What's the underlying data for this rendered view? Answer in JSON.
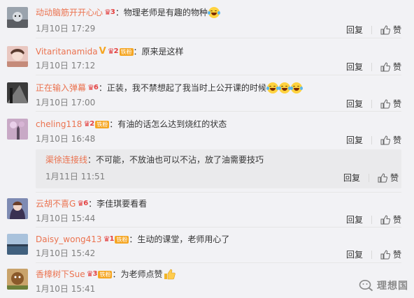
{
  "reply_label": "回复",
  "like_label": "赞",
  "comments": [
    {
      "username": "动动脑筋开开心心",
      "text": "：物理老师是有趣的物种",
      "time": "1月10日 17:29",
      "badges": [
        "vip3"
      ],
      "emoji": "laugh-cry"
    },
    {
      "username": "Vitaritanamida",
      "text": "：原来是这样",
      "time": "1月10日 17:12",
      "badges": [
        "v",
        "vip2",
        "fan"
      ],
      "fan_label": "铁粉"
    },
    {
      "username": "正在输入弹幕",
      "text": "：正装，我不禁想起了我当时上公开课的时候",
      "time": "1月10日 17:00",
      "badges": [
        "vip6"
      ],
      "emoji": "laugh-cry-x3"
    },
    {
      "username": "cheling118",
      "text": "：有油的话怎么达到烧红的状态",
      "time": "1月10日 16:48",
      "badges": [
        "vip2",
        "fan"
      ],
      "fan_label": "铁粉"
    },
    {
      "username": "云胡不喜G",
      "text": "：李佳琪要看看",
      "time": "1月10日 15:44",
      "badges": [
        "vip6"
      ]
    },
    {
      "username": "Daisy_wong413",
      "text": "：生动的课堂，老师用心了",
      "time": "1月10日 15:42",
      "badges": [
        "vip1",
        "fan"
      ],
      "fan_label": "铁粉"
    },
    {
      "username": "香樟树下Sue",
      "text": "：为老师点赞",
      "time": "1月10日 15:41",
      "badges": [
        "vip3",
        "fan"
      ],
      "fan_label": "铁粉",
      "emoji": "thumbs-up"
    }
  ],
  "sub_reply": {
    "username": "渠徐连接线",
    "text": "：不可能，不放油也可以不沾，放了油需要技巧",
    "time": "1月11日 11:51"
  },
  "watermark": {
    "text": "理想国",
    "icon": "wechat-search-icon"
  },
  "colors": {
    "username": "#eb7350",
    "vip": "#e34040",
    "fan_badge": "#f5a623",
    "background": "#f2f2f5"
  }
}
